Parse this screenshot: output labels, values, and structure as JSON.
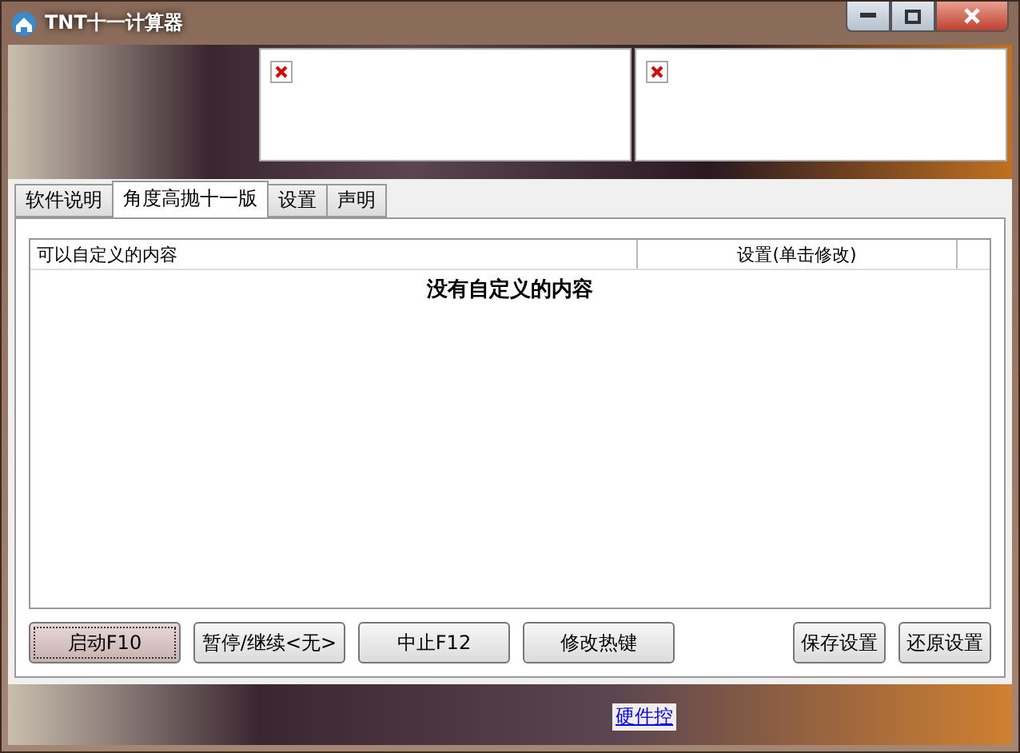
{
  "window": {
    "title": "TNT十一计算器"
  },
  "tabs": [
    {
      "label": "软件说明",
      "selected": false
    },
    {
      "label": "角度高抛十一版",
      "selected": true
    },
    {
      "label": "设置",
      "selected": false
    },
    {
      "label": "声明",
      "selected": false
    }
  ],
  "table": {
    "columns": [
      "可以自定义的内容",
      "设置(单击修改)"
    ],
    "empty_message": "没有自定义的内容"
  },
  "buttons": [
    {
      "label": "启动F10",
      "selected": true
    },
    {
      "label": "暂停/继续<无>",
      "selected": false
    },
    {
      "label": "中止F12",
      "selected": false
    },
    {
      "label": "修改热键",
      "selected": false
    }
  ],
  "right_buttons": [
    "保存设置",
    "还原设置"
  ],
  "footer": {
    "link": "硬件控"
  }
}
